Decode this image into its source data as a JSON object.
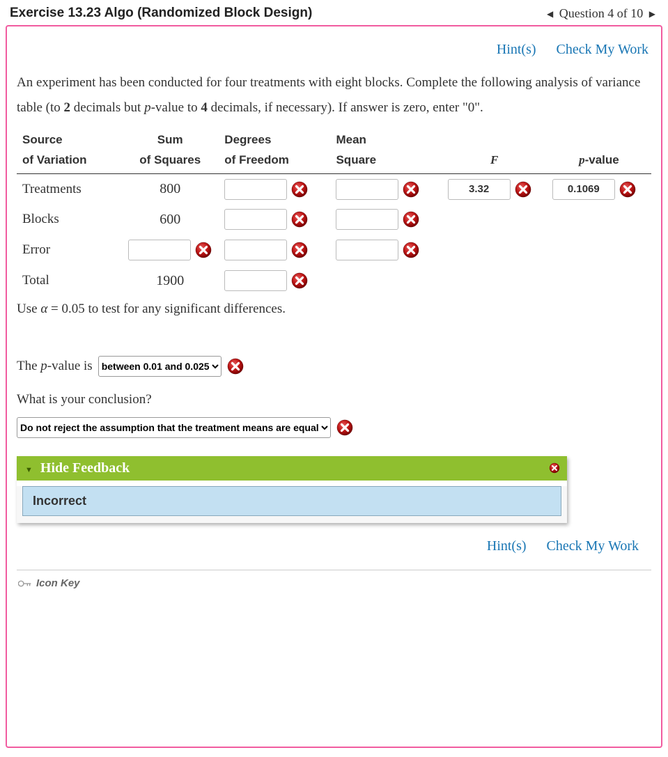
{
  "header": {
    "title": "Exercise 13.23 Algo (Randomized Block Design)",
    "nav_text": "Question 4 of 10"
  },
  "links": {
    "hints": "Hint(s)",
    "check": "Check My Work"
  },
  "instructions": "An experiment has been conducted for four treatments with eight blocks. Complete the following analysis of variance table (to 2 decimals but p-value to 4 decimals, if necessary). If answer is zero, enter \"0\".",
  "table": {
    "head": {
      "source1": "Source",
      "source2": "of Variation",
      "ss1": "Sum",
      "ss2": "of Squares",
      "df1": "Degrees",
      "df2": "of Freedom",
      "ms1": "Mean",
      "ms2": "Square",
      "f": "F",
      "p": "p-value"
    },
    "rows": {
      "treatments": {
        "label": "Treatments",
        "ss": "800",
        "f_val": "3.32",
        "p_val": "0.1069"
      },
      "blocks": {
        "label": "Blocks",
        "ss": "600"
      },
      "error": {
        "label": "Error"
      },
      "total": {
        "label": "Total",
        "ss": "1900"
      }
    }
  },
  "after": {
    "alpha_text_1": "Use ",
    "alpha_expr": "α = 0.05",
    "alpha_text_2": " to test for any significant differences.",
    "pvalue_lead": "The p-value is",
    "pvalue_option": "between 0.01 and 0.025",
    "conclusion_q": "What is your conclusion?",
    "conclusion_option": "Do not reject the assumption that the treatment means are equal"
  },
  "feedback": {
    "header": "Hide Feedback",
    "body": "Incorrect"
  },
  "icon_key": "Icon Key"
}
